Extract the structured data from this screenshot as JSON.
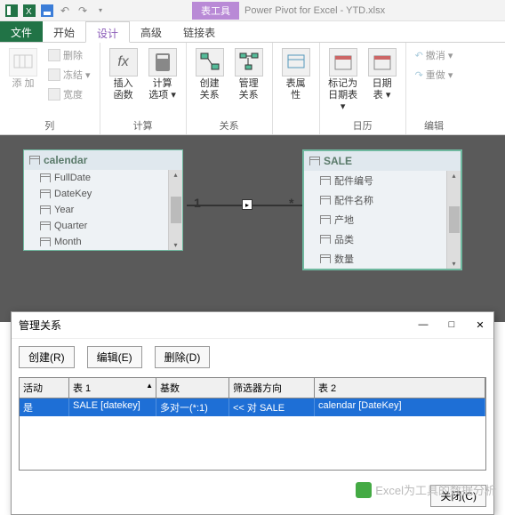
{
  "titlebar": {
    "context_tab": "表工具",
    "title": "Power Pivot for Excel - YTD.xlsx"
  },
  "tabs": {
    "file": "文件",
    "home": "开始",
    "design": "设计",
    "advanced": "高级",
    "linked": "链接表"
  },
  "ribbon": {
    "cols": {
      "add": "添\n加",
      "delete": "删除",
      "freeze": "冻结 ▾",
      "width": "宽度",
      "label": "列"
    },
    "calc": {
      "fx": "插入\n函数",
      "opts": "计算\n选项 ▾",
      "label": "计算"
    },
    "rel": {
      "create": "创建\n关系",
      "manage": "管理\n关系",
      "label": "关系"
    },
    "props": {
      "label_btn": "表属\n性"
    },
    "cal": {
      "mark": "标记为\n日期表 ▾",
      "date": "日期\n表 ▾",
      "label": "日历"
    },
    "edit": {
      "undo": "撤消 ▾",
      "redo": "重做 ▾",
      "label": "编辑"
    }
  },
  "diagram": {
    "t1": {
      "name": "calendar",
      "fields": [
        "FullDate",
        "DateKey",
        "Year",
        "Quarter",
        "Month"
      ]
    },
    "t2": {
      "name": "SALE",
      "fields": [
        "配件编号",
        "配件名称",
        "产地",
        "品类",
        "数量"
      ]
    },
    "one": "1",
    "many": "*",
    "arrow": "▸"
  },
  "dialog": {
    "title": "管理关系",
    "create": "创建(R)",
    "edit": "编辑(E)",
    "delete": "删除(D)",
    "cols": {
      "active": "活动",
      "t1": "表 1",
      "card": "基数",
      "filter": "筛选器方向",
      "t2": "表 2"
    },
    "row": {
      "active": "是",
      "t1": "SALE [datekey]",
      "card": "多对一(*:1)",
      "filter": "<< 对 SALE",
      "t2": "calendar [DateKey]"
    },
    "close": "关闭(C)"
  },
  "watermark": "Excel为工具的数据分析"
}
